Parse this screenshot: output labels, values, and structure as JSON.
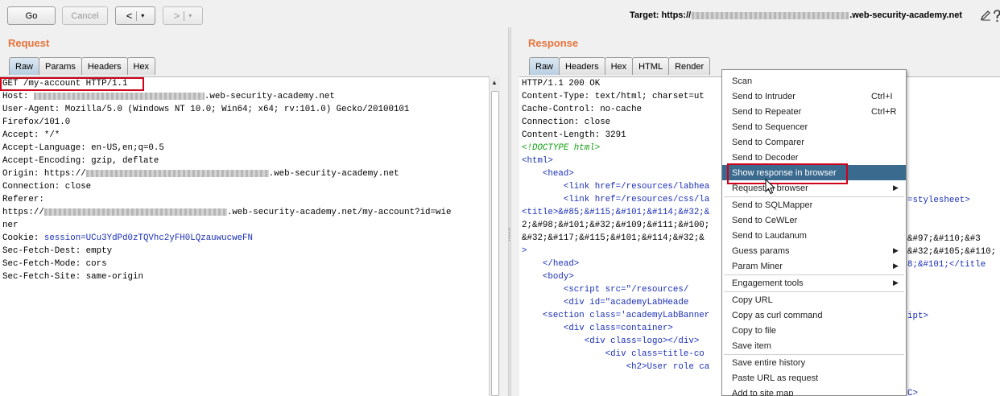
{
  "toolbar": {
    "go_label": "Go",
    "cancel_label": "Cancel",
    "back_label": "<",
    "forward_label": ">",
    "dropdown_caret": "▾",
    "target_prefix": "Target: https://",
    "target_suffix": ".web-security-academy.net"
  },
  "request": {
    "title": "Request",
    "tabs": [
      "Raw",
      "Params",
      "Headers",
      "Hex"
    ],
    "lines": [
      "GET /my-account HTTP/1.1",
      "Host: ",
      "User-Agent: Mozilla/5.0 (Windows NT 10.0; Win64; x64; rv:101.0) Gecko/20100101",
      "Firefox/101.0",
      "Accept: */*",
      "Accept-Language: en-US,en;q=0.5",
      "Accept-Encoding: gzip, deflate",
      "Origin: https://",
      "Connection: close",
      "Referer:",
      "https://",
      "ner",
      "Cookie: ",
      "Sec-Fetch-Dest: empty",
      "Sec-Fetch-Mode: cors",
      "Sec-Fetch-Site: same-origin"
    ],
    "host_suffix": ".web-security-academy.net",
    "origin_suffix": ".web-security-academy.net",
    "referer_suffix": ".web-security-academy.net/my-account?id=wie",
    "cookie_value": "session=UCu3YdPd0zTQVhc2yFH0LQzauwucweFN"
  },
  "response": {
    "title": "Response",
    "tabs": [
      "Raw",
      "Headers",
      "Hex",
      "HTML",
      "Render"
    ],
    "lines": [
      "HTTP/1.1 200 OK",
      "Content-Type: text/html; charset=ut",
      "Cache-Control: no-cache",
      "Connection: close",
      "Content-Length: 3291",
      "",
      "<!DOCTYPE html>",
      "<html>",
      "    <head>",
      "        <link href=/resources/labhea",
      "        <link href=/resources/css/la",
      "",
      "<title>&#85;&#115;&#101;&#114;&#32;&",
      "2;&#98;&#101;&#32;&#109;&#111;&#100;",
      "&#32;&#117;&#115;&#101;&#114;&#32;&",
      ">",
      "    </head>",
      "    <body>",
      "        <script src=\"/resources/",
      "        <div id=\"academyLabHeade",
      "    <section class='academyLabBanner",
      "        <div class=container>",
      "            <div class=logo></div>",
      "                <div class=title-co",
      "                    <h2>User role ca"
    ],
    "hidden_right": {
      "r9": "=stylesheet>",
      "r12": "&#97;&#110;&#3",
      "r13": "&#32;&#105;&#110;",
      "r14": "8;&#101;</title",
      "r18": "ipt>",
      "r24": "C>"
    }
  },
  "context_menu": {
    "items": [
      {
        "label": "Scan",
        "shortcut": "",
        "submenu": false
      },
      {
        "label": "Send to Intruder",
        "shortcut": "Ctrl+I",
        "submenu": false
      },
      {
        "label": "Send to Repeater",
        "shortcut": "Ctrl+R",
        "submenu": false
      },
      {
        "label": "Send to Sequencer",
        "shortcut": "",
        "submenu": false
      },
      {
        "label": "Send to Comparer",
        "shortcut": "",
        "submenu": false
      },
      {
        "label": "Send to Decoder",
        "shortcut": "",
        "submenu": false
      },
      {
        "label": "Show response in browser",
        "shortcut": "",
        "submenu": false,
        "selected": true
      },
      {
        "label": "Request in browser",
        "shortcut": "",
        "submenu": true
      },
      {
        "label": "Send to SQLMapper",
        "shortcut": "",
        "submenu": false
      },
      {
        "label": "Send to CeWLer",
        "shortcut": "",
        "submenu": false
      },
      {
        "label": "Send to Laudanum",
        "shortcut": "",
        "submenu": false
      },
      {
        "label": "Guess params",
        "shortcut": "",
        "submenu": true
      },
      {
        "label": "Param Miner",
        "shortcut": "",
        "submenu": true
      },
      {
        "label": "Engagement tools",
        "shortcut": "",
        "submenu": true
      },
      {
        "label": "Copy URL",
        "shortcut": "",
        "submenu": false
      },
      {
        "label": "Copy as curl command",
        "shortcut": "",
        "submenu": false
      },
      {
        "label": "Copy to file",
        "shortcut": "",
        "submenu": false
      },
      {
        "label": "Save item",
        "shortcut": "",
        "submenu": false
      },
      {
        "label": "Save entire history",
        "shortcut": "",
        "submenu": false
      },
      {
        "label": "Paste URL as request",
        "shortcut": "",
        "submenu": false
      },
      {
        "label": "Add to site map",
        "shortcut": "",
        "submenu": false
      }
    ]
  },
  "colors": {
    "pane_title": "#e8743b",
    "highlight_box": "#d0021b",
    "menu_selected": "#3b6a8f",
    "cookie_value": "#1a2fb7",
    "comment": "#10a010"
  },
  "icons": [
    "edit-pencil-icon",
    "help-icon",
    "scroll-up-arrow-icon",
    "submenu-arrow-icon",
    "mouse-cursor-icon"
  ]
}
